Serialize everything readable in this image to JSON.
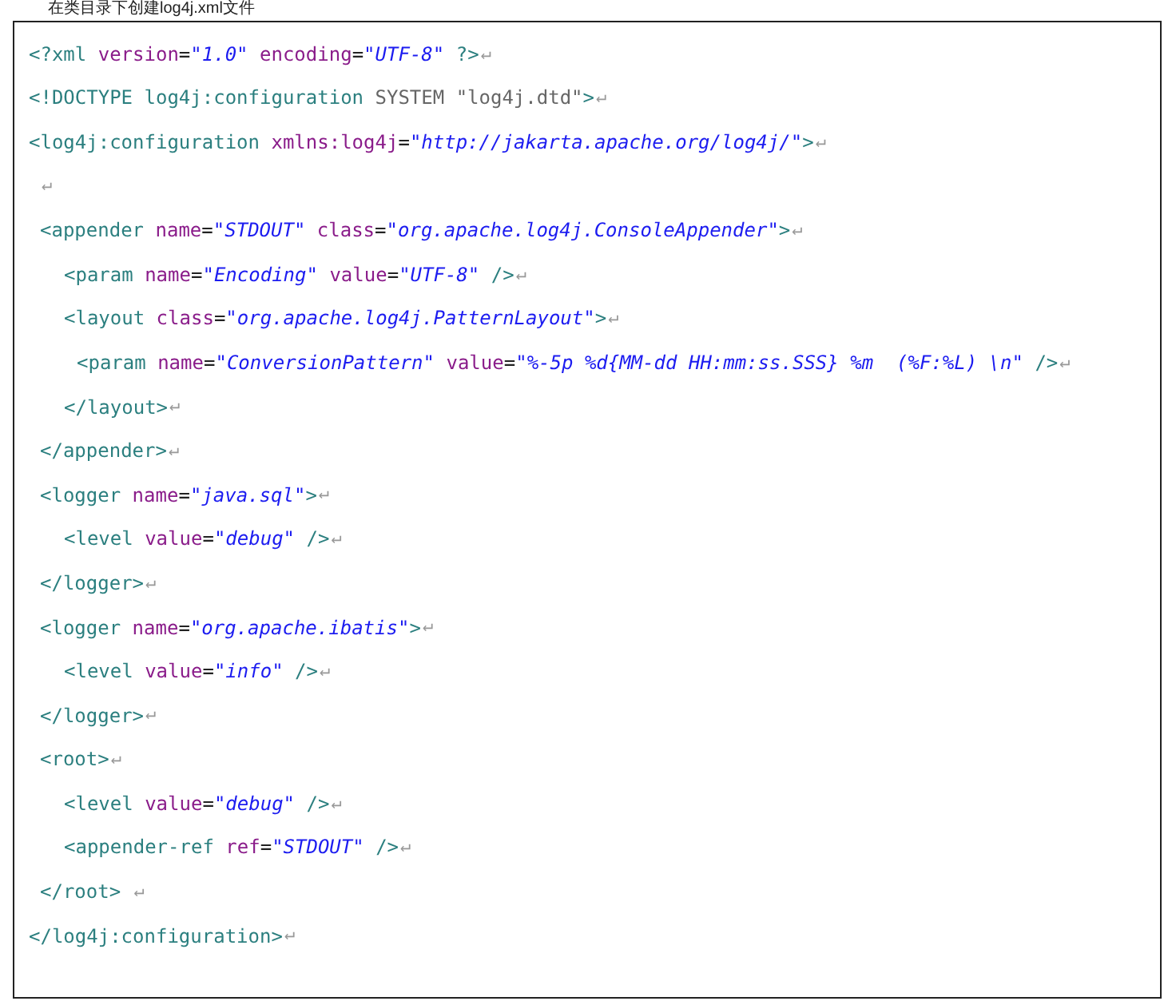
{
  "heading": "在类目录下创建log4j.xml文件",
  "lines": [
    {
      "parts": [
        {
          "kind": "tag",
          "text": "<?xml"
        },
        {
          "kind": "attr",
          "text": " version"
        },
        {
          "kind": "eq",
          "text": "="
        },
        {
          "kind": "string",
          "text": "\"1.0\""
        },
        {
          "kind": "attr",
          "text": " encoding"
        },
        {
          "kind": "eq",
          "text": "="
        },
        {
          "kind": "string",
          "text": "\"UTF-8\""
        },
        {
          "kind": "tag",
          "text": " ?>"
        }
      ],
      "end_mark": "↵"
    },
    {
      "parts": [
        {
          "kind": "tag",
          "text": "<!DOCTYPE log4j:configuration"
        },
        {
          "kind": "text",
          "text": " SYSTEM \"log4j.dtd\""
        },
        {
          "kind": "tag",
          "text": ">"
        }
      ],
      "end_mark": "↵"
    },
    {
      "parts": [
        {
          "kind": "tag",
          "text": "<log4j:configuration"
        },
        {
          "kind": "attr",
          "text": " xmlns:log4j"
        },
        {
          "kind": "eq",
          "text": "="
        },
        {
          "kind": "string",
          "text": "\"http://jakarta.apache.org/log4j/\""
        },
        {
          "kind": "tag",
          "text": ">"
        }
      ],
      "end_mark": "↵",
      "children": [
        {
          "end_mark": "↵"
        },
        {
          "parts": [
            {
              "kind": "tag",
              "text": "<appender"
            },
            {
              "kind": "attr",
              "text": " name"
            },
            {
              "kind": "eq",
              "text": "="
            },
            {
              "kind": "string",
              "text": "\"STDOUT\""
            },
            {
              "kind": "attr",
              "text": " class"
            },
            {
              "kind": "eq",
              "text": "="
            },
            {
              "kind": "string",
              "text": "\"org.apache.log4j.ConsoleAppender\""
            },
            {
              "kind": "tag",
              "text": ">"
            }
          ],
          "end_mark": "↵",
          "children": [
            {
              "parts": [
                {
                  "kind": "tag",
                  "text": "<param"
                },
                {
                  "kind": "attr",
                  "text": " name"
                },
                {
                  "kind": "eq",
                  "text": "="
                },
                {
                  "kind": "string",
                  "text": "\"Encoding\""
                },
                {
                  "kind": "attr",
                  "text": " value"
                },
                {
                  "kind": "eq",
                  "text": "="
                },
                {
                  "kind": "string",
                  "text": "\"UTF-8\""
                },
                {
                  "kind": "tag",
                  "text": " />"
                }
              ],
              "end_mark": "↵"
            },
            {
              "parts": [
                {
                  "kind": "tag",
                  "text": "<layout"
                },
                {
                  "kind": "attr",
                  "text": " class"
                },
                {
                  "kind": "eq",
                  "text": "="
                },
                {
                  "kind": "string",
                  "text": "\"org.apache.log4j.PatternLayout\""
                },
                {
                  "kind": "tag",
                  "text": ">"
                }
              ],
              "end_mark": "↵",
              "children": [
                {
                  "parts": [
                    {
                      "kind": "tag",
                      "text": "<param"
                    },
                    {
                      "kind": "attr",
                      "text": " name"
                    },
                    {
                      "kind": "eq",
                      "text": "="
                    },
                    {
                      "kind": "string",
                      "text": "\"ConversionPattern\""
                    },
                    {
                      "kind": "attr",
                      "text": " value"
                    },
                    {
                      "kind": "eq",
                      "text": "="
                    },
                    {
                      "kind": "string",
                      "text": "\"%-5p %d{MM-dd HH:mm:ss.SSS} %m  (%F:%L) \\n\""
                    },
                    {
                      "kind": "tag",
                      "text": " />"
                    }
                  ],
                  "end_mark": "↵"
                }
              ]
            },
            {
              "parts": [
                {
                  "kind": "tag",
                  "text": "</layout>"
                }
              ],
              "end_mark": "↵"
            }
          ]
        },
        {
          "parts": [
            {
              "kind": "tag",
              "text": "</appender>"
            }
          ],
          "end_mark": "↵"
        },
        {
          "parts": [
            {
              "kind": "tag",
              "text": "<logger"
            },
            {
              "kind": "attr",
              "text": " name"
            },
            {
              "kind": "eq",
              "text": "="
            },
            {
              "kind": "string",
              "text": "\"java.sql\""
            },
            {
              "kind": "tag",
              "text": ">"
            }
          ],
          "end_mark": "↵",
          "children": [
            {
              "parts": [
                {
                  "kind": "tag",
                  "text": "<level"
                },
                {
                  "kind": "attr",
                  "text": " value"
                },
                {
                  "kind": "eq",
                  "text": "="
                },
                {
                  "kind": "string",
                  "text": "\"debug\""
                },
                {
                  "kind": "tag",
                  "text": " />"
                }
              ],
              "end_mark": "↵"
            }
          ]
        },
        {
          "parts": [
            {
              "kind": "tag",
              "text": "</logger>"
            }
          ],
          "end_mark": "↵"
        },
        {
          "parts": [
            {
              "kind": "tag",
              "text": "<logger"
            },
            {
              "kind": "attr",
              "text": " name"
            },
            {
              "kind": "eq",
              "text": "="
            },
            {
              "kind": "string",
              "text": "\"org.apache.ibatis\""
            },
            {
              "kind": "tag",
              "text": ">"
            }
          ],
          "end_mark": "↵",
          "children": [
            {
              "parts": [
                {
                  "kind": "tag",
                  "text": "<level"
                },
                {
                  "kind": "attr",
                  "text": " value"
                },
                {
                  "kind": "eq",
                  "text": "="
                },
                {
                  "kind": "string",
                  "text": "\"info\""
                },
                {
                  "kind": "tag",
                  "text": " />"
                }
              ],
              "end_mark": "↵"
            }
          ]
        },
        {
          "parts": [
            {
              "kind": "tag",
              "text": "</logger>"
            }
          ],
          "end_mark": "↵"
        },
        {
          "parts": [
            {
              "kind": "tag",
              "text": "<root>"
            }
          ],
          "end_mark": "↵",
          "children": [
            {
              "parts": [
                {
                  "kind": "tag",
                  "text": "<level"
                },
                {
                  "kind": "attr",
                  "text": " value"
                },
                {
                  "kind": "eq",
                  "text": "="
                },
                {
                  "kind": "string",
                  "text": "\"debug\""
                },
                {
                  "kind": "tag",
                  "text": " />"
                }
              ],
              "end_mark": "↵"
            },
            {
              "parts": [
                {
                  "kind": "tag",
                  "text": "<appender-ref"
                },
                {
                  "kind": "attr",
                  "text": " ref"
                },
                {
                  "kind": "eq",
                  "text": "="
                },
                {
                  "kind": "string",
                  "text": "\"STDOUT\""
                },
                {
                  "kind": "tag",
                  "text": " />"
                }
              ],
              "end_mark": "↵"
            }
          ]
        },
        {
          "parts": [
            {
              "kind": "tag",
              "text": "</root> "
            }
          ],
          "end_mark": "↵"
        }
      ]
    },
    {
      "parts": [
        {
          "kind": "tag",
          "text": "</log4j:configuration>"
        }
      ],
      "end_mark": "↵"
    }
  ]
}
